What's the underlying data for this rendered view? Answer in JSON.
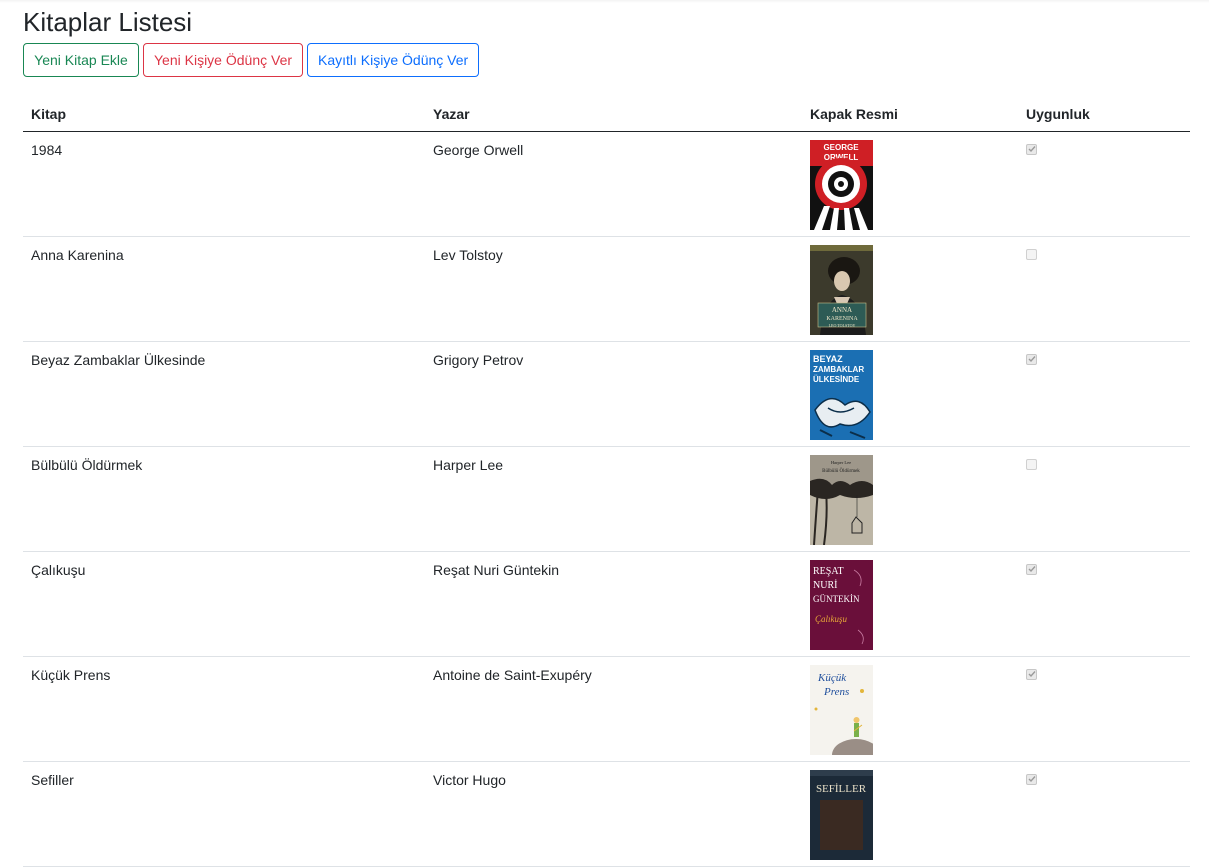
{
  "title": "Kitaplar Listesi",
  "buttons": {
    "add_book": "Yeni Kitap Ekle",
    "lend_new": "Yeni Kişiye Ödünç Ver",
    "lend_registered": "Kayıtlı Kişiye Ödünç Ver"
  },
  "table": {
    "headers": {
      "book": "Kitap",
      "author": "Yazar",
      "cover": "Kapak Resmi",
      "available": "Uygunluk"
    },
    "rows": [
      {
        "book": "1984",
        "author": "George Orwell",
        "cover_icon": "orwell-1984-cover",
        "available": true,
        "cover_text": [
          "GEORGE",
          "ORWELL"
        ]
      },
      {
        "book": "Anna Karenina",
        "author": "Lev Tolstoy",
        "cover_icon": "anna-karenina-cover",
        "available": false,
        "cover_text": [
          "ANNA",
          "KARENINA",
          "LEO TOLSTOY"
        ]
      },
      {
        "book": "Beyaz Zambaklar Ülkesinde",
        "author": "Grigory Petrov",
        "cover_icon": "beyaz-zambaklar-cover",
        "available": true,
        "cover_text": [
          "BEYAZ",
          "ZAMBAKLAR",
          "ÜLKESİNDE"
        ]
      },
      {
        "book": "Bülbülü Öldürmek",
        "author": "Harper Lee",
        "cover_icon": "bulbulu-oldurmek-cover",
        "available": false,
        "cover_text": [
          "Harper Lee",
          "Bülbülü Öldürmek"
        ]
      },
      {
        "book": "Çalıkuşu",
        "author": "Reşat Nuri Güntekin",
        "cover_icon": "calikusu-cover",
        "available": true,
        "cover_text": [
          "REŞAT",
          "NURİ",
          "GÜNTEKİN",
          "Çalıkuşu"
        ]
      },
      {
        "book": "Küçük Prens",
        "author": "Antoine de Saint-Exupéry",
        "cover_icon": "kucuk-prens-cover",
        "available": true,
        "cover_text": [
          "Küçük",
          "Prens"
        ]
      },
      {
        "book": "Sefiller",
        "author": "Victor Hugo",
        "cover_icon": "sefiller-cover",
        "available": true,
        "cover_text": [
          "SEFİLLER"
        ]
      }
    ]
  },
  "colors": {
    "green": "#198754",
    "red": "#dc3545",
    "blue": "#0d6efd",
    "text": "#212529",
    "row_border": "#dee2e6"
  }
}
